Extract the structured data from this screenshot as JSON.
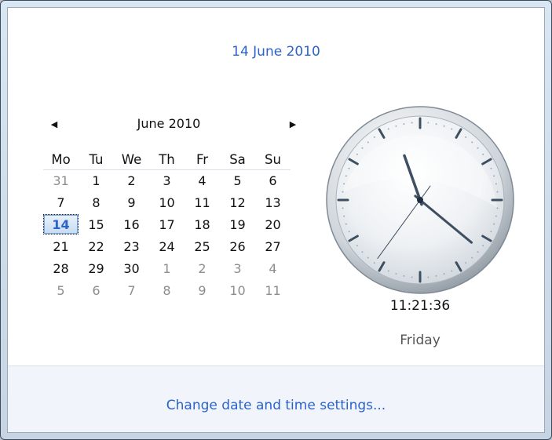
{
  "header": {
    "date_long": "14 June 2010"
  },
  "calendar": {
    "month_title": "June 2010",
    "prev_icon": "triangle-left-icon",
    "next_icon": "triangle-right-icon",
    "weekdays": [
      "Mo",
      "Tu",
      "We",
      "Th",
      "Fr",
      "Sa",
      "Su"
    ],
    "weeks": [
      [
        {
          "d": "31",
          "o": 1
        },
        {
          "d": "1"
        },
        {
          "d": "2"
        },
        {
          "d": "3"
        },
        {
          "d": "4"
        },
        {
          "d": "5"
        },
        {
          "d": "6"
        }
      ],
      [
        {
          "d": "7"
        },
        {
          "d": "8"
        },
        {
          "d": "9"
        },
        {
          "d": "10"
        },
        {
          "d": "11"
        },
        {
          "d": "12"
        },
        {
          "d": "13"
        }
      ],
      [
        {
          "d": "14",
          "t": 1
        },
        {
          "d": "15"
        },
        {
          "d": "16"
        },
        {
          "d": "17"
        },
        {
          "d": "18"
        },
        {
          "d": "19"
        },
        {
          "d": "20"
        }
      ],
      [
        {
          "d": "21"
        },
        {
          "d": "22"
        },
        {
          "d": "23"
        },
        {
          "d": "24"
        },
        {
          "d": "25"
        },
        {
          "d": "26"
        },
        {
          "d": "27"
        }
      ],
      [
        {
          "d": "28"
        },
        {
          "d": "29"
        },
        {
          "d": "30"
        },
        {
          "d": "1",
          "o": 1
        },
        {
          "d": "2",
          "o": 1
        },
        {
          "d": "3",
          "o": 1
        },
        {
          "d": "4",
          "o": 1
        }
      ],
      [
        {
          "d": "5",
          "o": 1
        },
        {
          "d": "6",
          "o": 1
        },
        {
          "d": "7",
          "o": 1
        },
        {
          "d": "8",
          "o": 1
        },
        {
          "d": "9",
          "o": 1
        },
        {
          "d": "10",
          "o": 1
        },
        {
          "d": "11",
          "o": 1
        }
      ]
    ]
  },
  "clock": {
    "time": "11:21:36",
    "day_name": "Friday",
    "hours": 11,
    "minutes": 21,
    "seconds": 36
  },
  "footer": {
    "link_label": "Change date and time settings..."
  },
  "colors": {
    "accent": "#2b63c9",
    "muted_day": "#8d8d8d"
  }
}
